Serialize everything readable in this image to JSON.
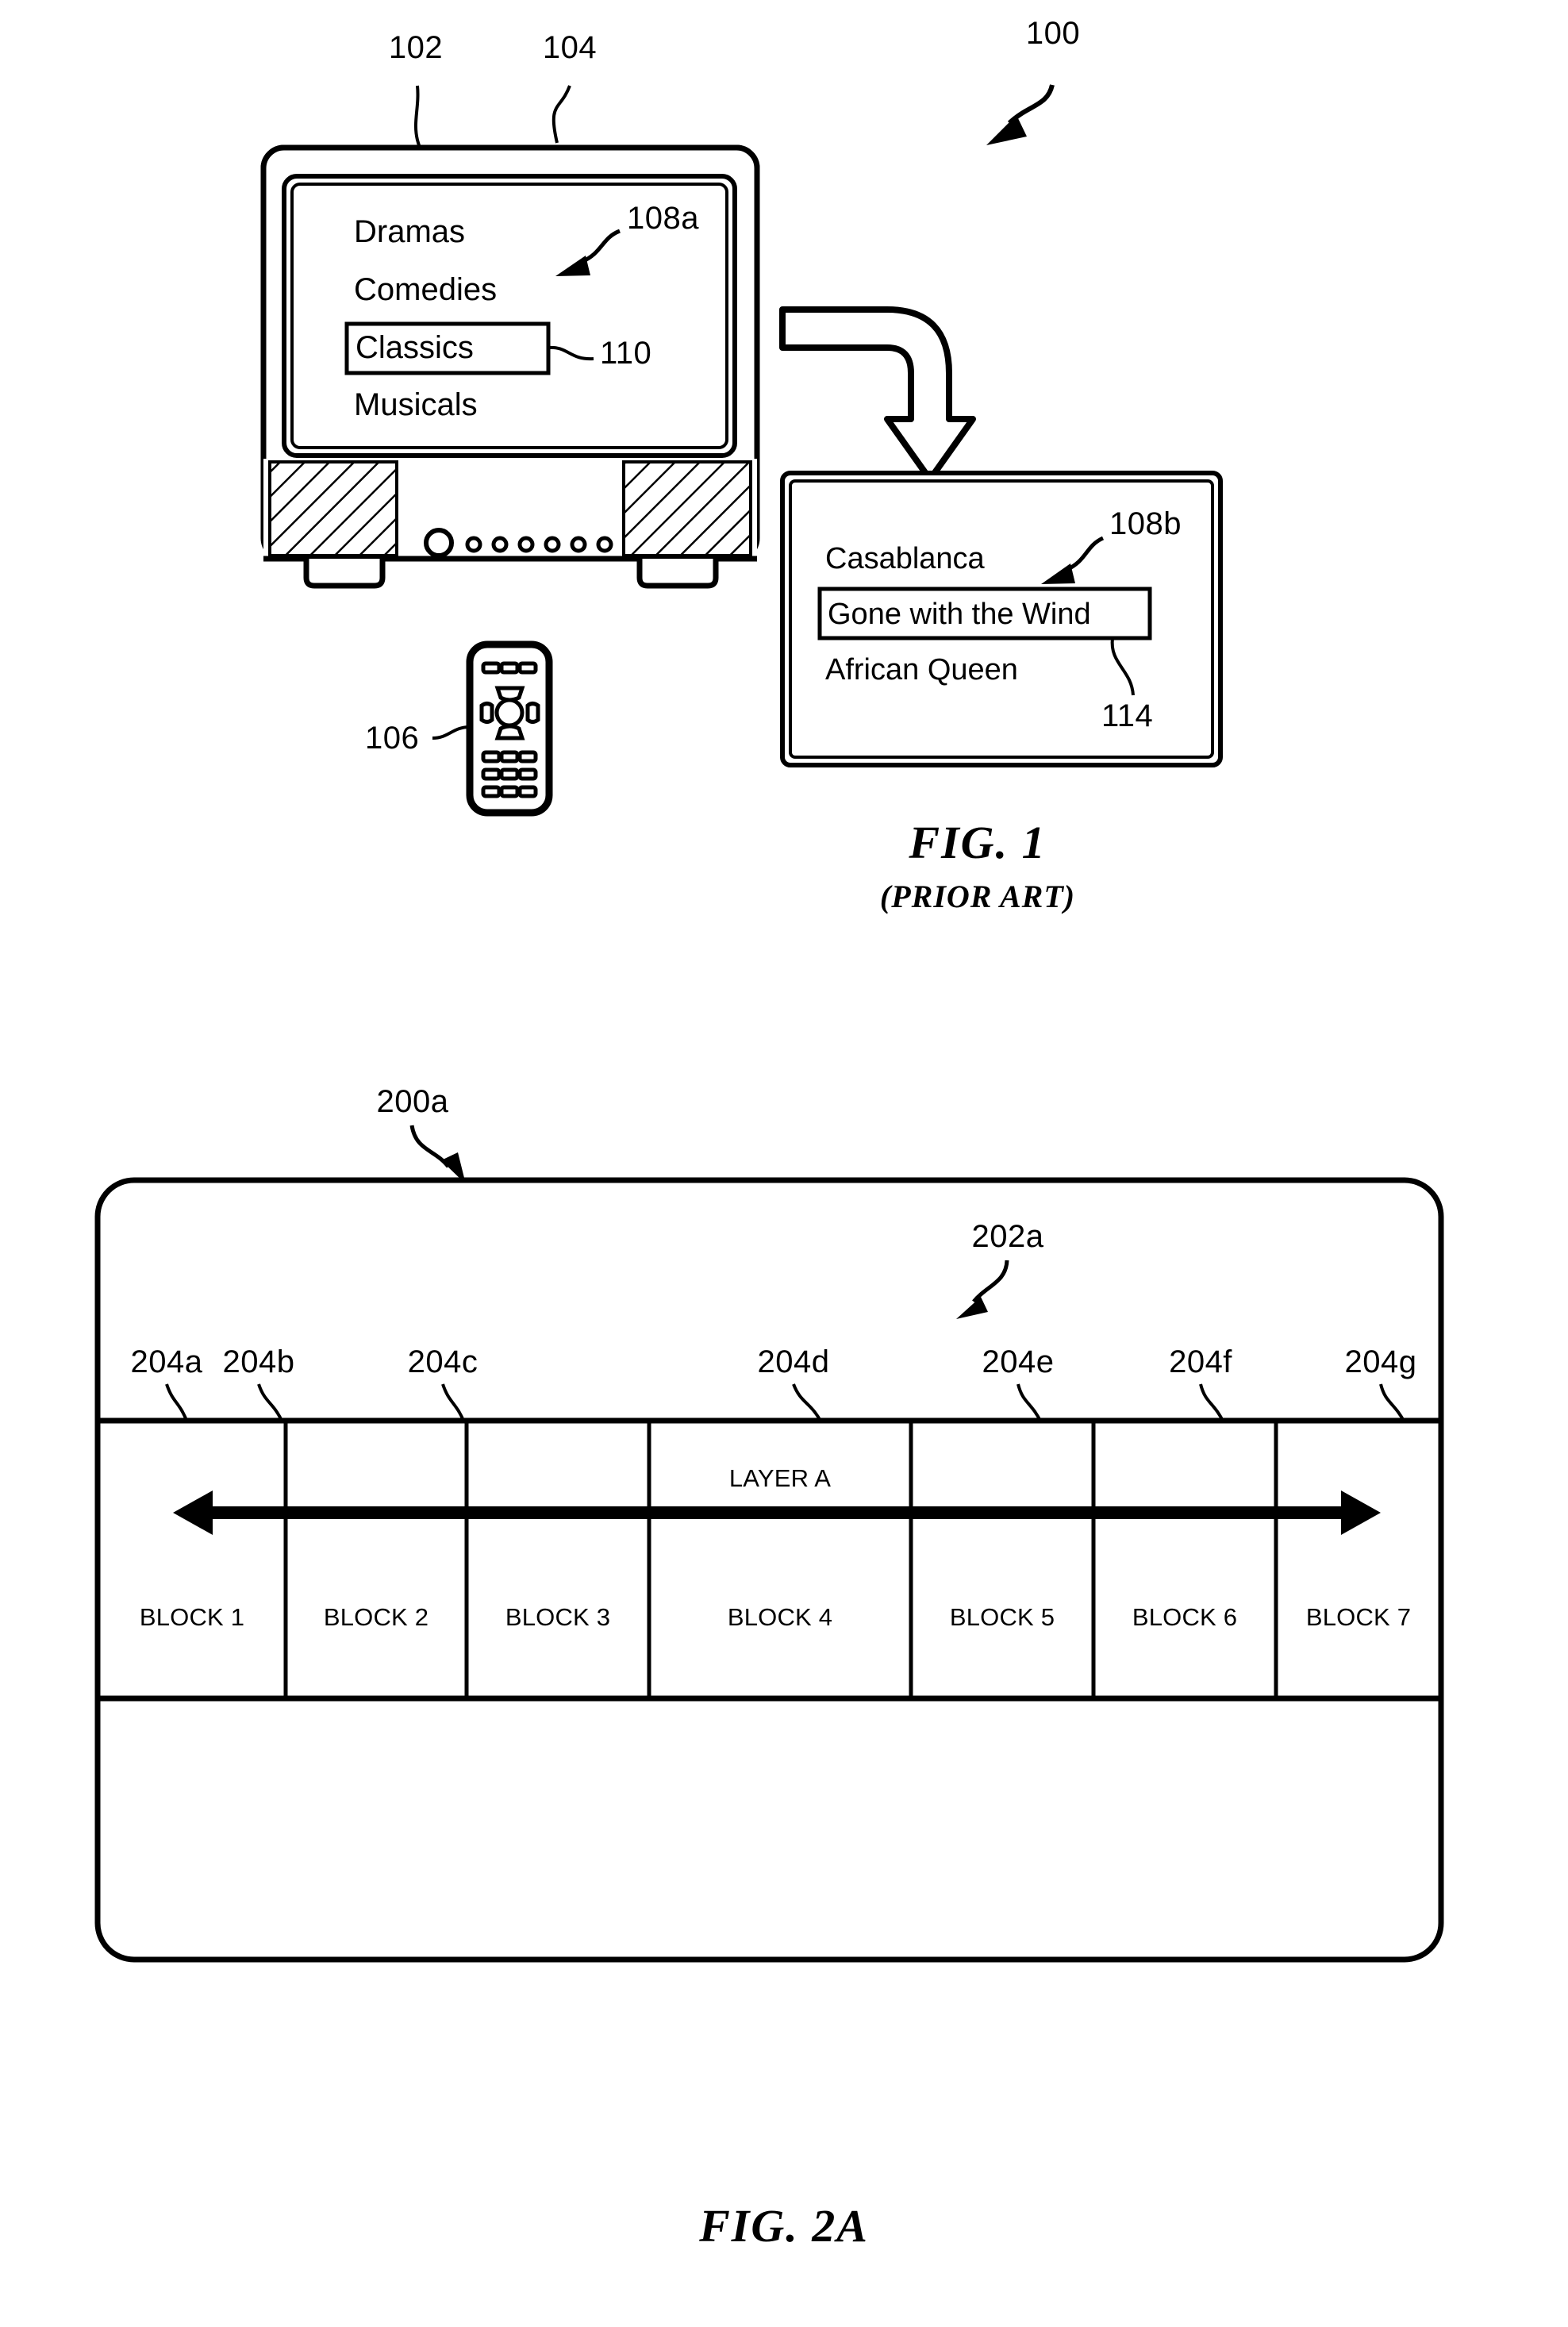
{
  "document": {
    "type": "patent-figure-sheet",
    "figures": [
      "FIG. 1",
      "FIG. 2A"
    ]
  },
  "fig1": {
    "caption": "FIG. 1",
    "subcaption": "(PRIOR ART)",
    "ref_system": "100",
    "ref_tv_screen": "102",
    "ref_tv_housing": "104",
    "ref_remote": "106",
    "ref_menu_a": "108a",
    "ref_menu_b": "108b",
    "ref_highlight_a": "110",
    "ref_highlight_b": "114",
    "menu_a": {
      "items": [
        "Dramas",
        "Comedies",
        "Classics",
        "Musicals"
      ],
      "selected": "Classics"
    },
    "menu_b": {
      "items": [
        "Casablanca",
        "Gone with the Wind",
        "African Queen"
      ],
      "selected": "Gone with the Wind"
    }
  },
  "fig2a": {
    "caption": "FIG. 2A",
    "ref_frame": "200a",
    "ref_layer_region": "202a",
    "layer_label": "LAYER A",
    "block_refs": [
      "204a",
      "204b",
      "204c",
      "204d",
      "204e",
      "204f",
      "204g"
    ],
    "blocks": [
      "BLOCK 1",
      "BLOCK 2",
      "BLOCK 3",
      "BLOCK 4",
      "BLOCK 5",
      "BLOCK 6",
      "BLOCK 7"
    ]
  },
  "colors": {
    "ink": "#000000",
    "paper": "#ffffff"
  }
}
